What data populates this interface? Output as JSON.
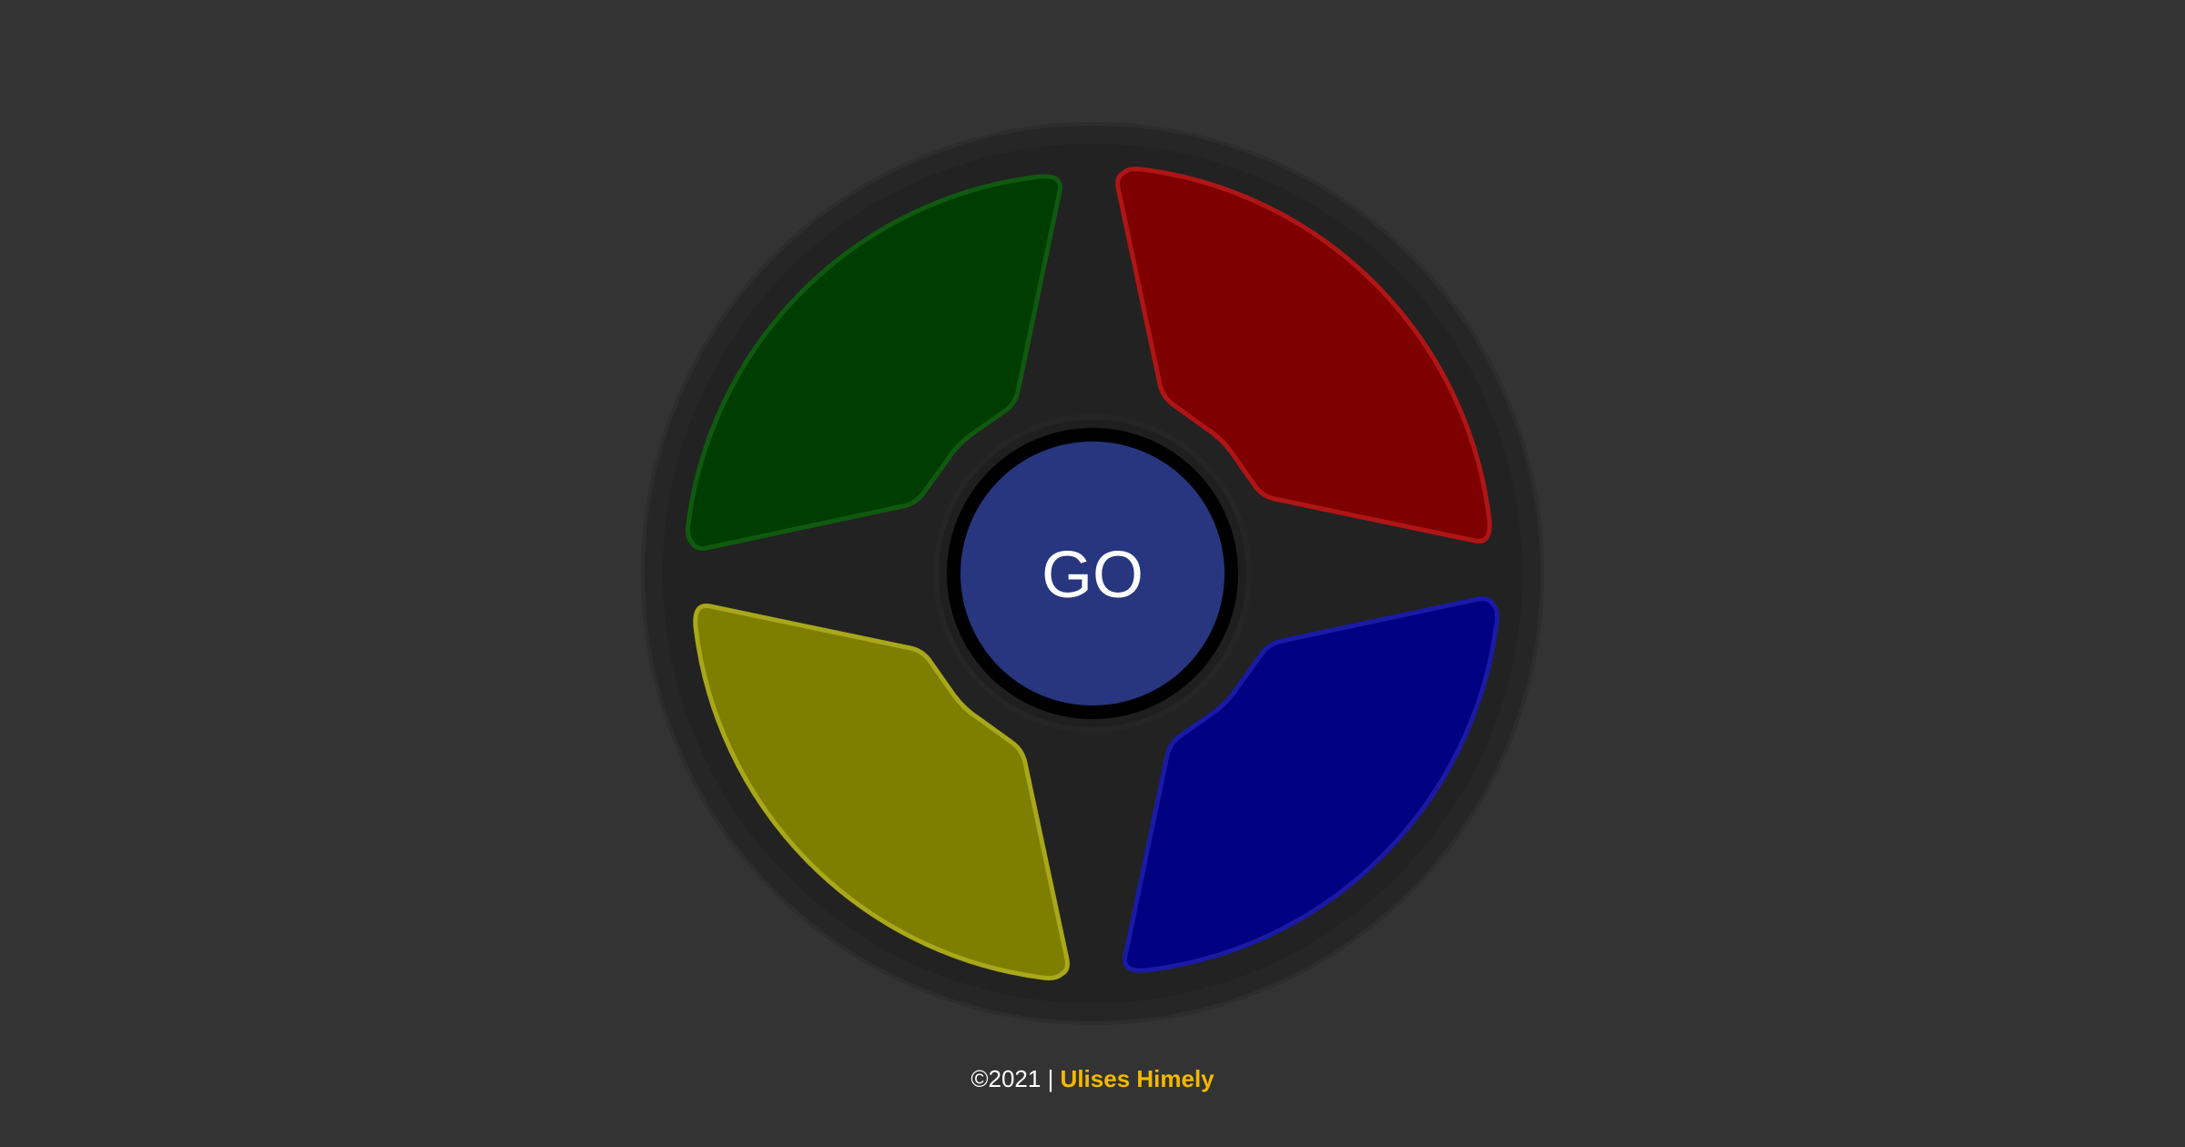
{
  "game": {
    "start_button_label": "GO",
    "pads": [
      {
        "id": "green",
        "color": "#003d00",
        "outline": "#0f5a0f"
      },
      {
        "id": "red",
        "color": "#7e0000",
        "outline": "#b01515"
      },
      {
        "id": "yellow",
        "color": "#7e7e00",
        "outline": "#a8a81a"
      },
      {
        "id": "blue",
        "color": "#000082",
        "outline": "#1a1aa6"
      }
    ],
    "start_button_color": "#27367f",
    "board_color": "#222222",
    "rim_color": "#2a2a2a"
  },
  "footer": {
    "copyright": "©2021 | ",
    "author": "Ulises Himely",
    "author_color": "#f5b800"
  }
}
